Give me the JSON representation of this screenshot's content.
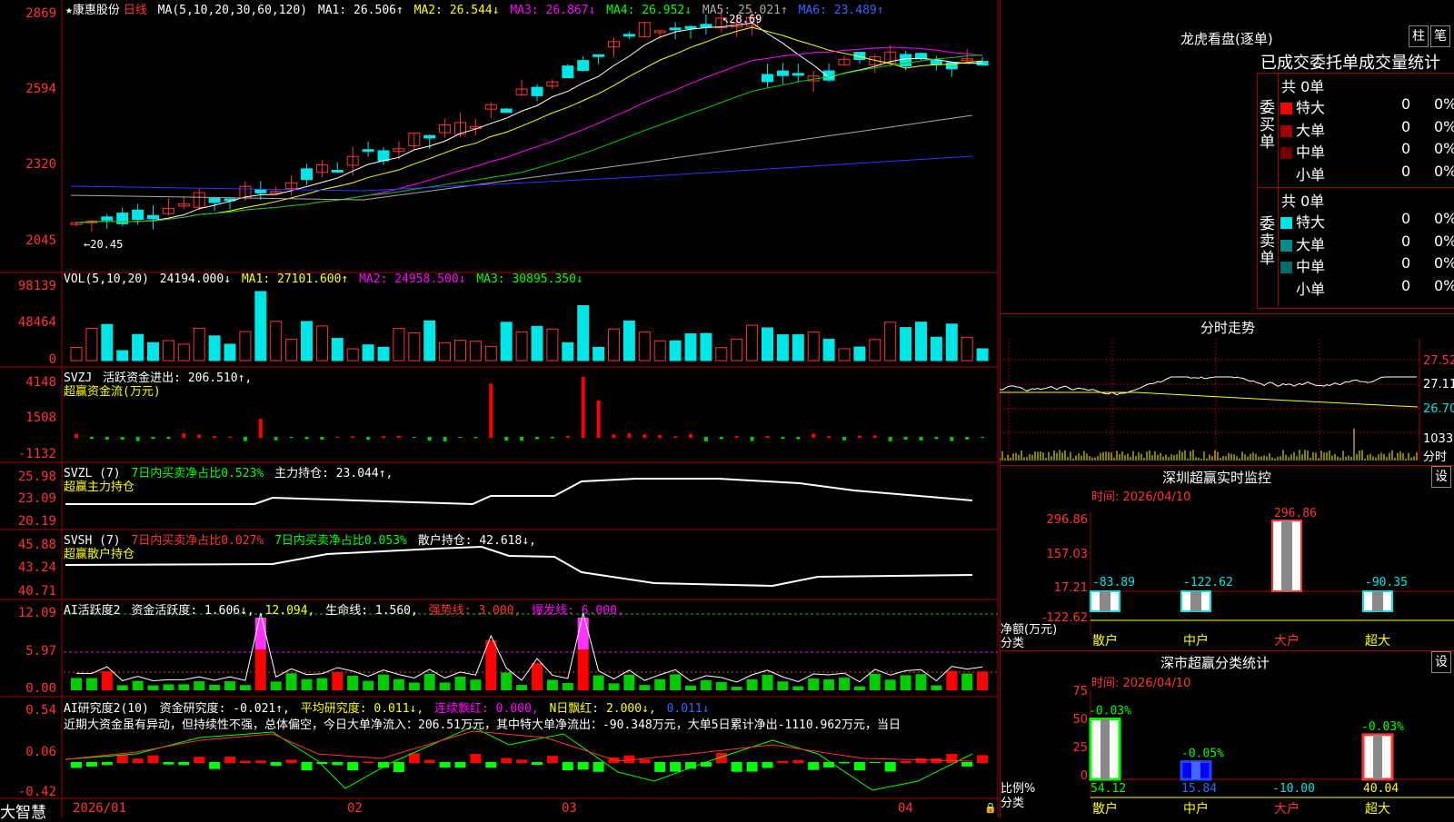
{
  "stock": {
    "name": "★康惠股份",
    "period": "日线"
  },
  "ma_header": {
    "label": "MA(5,10,20,30,60,120)",
    "ma1": "MA1: 26.506↑",
    "ma2": "MA2: 26.544↓",
    "ma3": "MA3: 26.867↓",
    "ma4": "MA4: 26.952↓",
    "ma5": "MA5: 25.021↑",
    "ma6": "MA6: 23.489↑"
  },
  "price_axis": [
    "2869",
    "2594",
    "2320",
    "2045"
  ],
  "price_notes": {
    "high": "28.69",
    "low": "20.45"
  },
  "vol": {
    "label": "VOL(5,10,20)",
    "v": "24194.000↓",
    "ma1": "MA1: 27101.600↑",
    "ma2": "MA2: 24958.500↓",
    "ma3": "MA3: 30895.350↓",
    "axis": [
      "98139",
      "48464",
      "0"
    ]
  },
  "svzj": {
    "label": "SVZJ",
    "text": "活跃资金进出: 206.510↑,",
    "sub": "超赢资金流(万元)",
    "axis": [
      "4148",
      "1508",
      "-1132"
    ]
  },
  "svzl": {
    "label": "SVZL (7)",
    "t1": "7日内买卖净占比0.523%",
    "t2": "主力持仓: 23.044↑,",
    "sub": "超赢主力持仓",
    "axis": [
      "25.98",
      "23.09",
      "20.19"
    ]
  },
  "svsh": {
    "label": "SVSH (7)",
    "t1": "7日内买卖净占比0.027%",
    "t2": "7日内买卖净占比0.053%",
    "t3": "散户持仓: 42.618↓,",
    "sub": "超赢散户持仓",
    "axis": [
      "45.88",
      "43.24",
      "40.71"
    ]
  },
  "ai1": {
    "label": "AI活跃度2",
    "t1": "资金活跃度: 1.606↓,",
    "t2": "12.094,",
    "t3": "生命线: 1.560,",
    "t4": "强势线: 3.000,",
    "t5": "爆发线: 6.000,",
    "axis": [
      "12.09",
      "5.97",
      "0.00"
    ]
  },
  "ai2": {
    "label": "AI研究度2(10)",
    "t1": "资金研究度: -0.021↑,",
    "t2": "平均研究度: 0.011↓,",
    "t3": "连续飘红: 0.000,",
    "t4": "N日飘红: 2.000↓,",
    "t5": "0.011↓",
    "note": "近期大资金虽有异动，但持续性不强，总体偏空，今日大单净流入：206.51万元，其中特大单净流出：-90.348万元，大单5日累计净出-1110.962万元，当日",
    "axis": [
      "0.54",
      "0.06",
      "-0.42"
    ]
  },
  "dates": [
    "2026/01",
    "02",
    "03",
    "04"
  ],
  "brand": "大智慧",
  "right": {
    "title": "龙虎看盘(逐单)",
    "btn1": "柱",
    "btn2": "笔",
    "tabs": "已成交委托单成交量统计",
    "buy": {
      "label": "委买单",
      "count": "共 0单",
      "rows": [
        {
          "name": "特大",
          "v": "0",
          "p": "0%",
          "c": "#ff0000"
        },
        {
          "name": "大单",
          "v": "0",
          "p": "0%",
          "c": "#a00000"
        },
        {
          "name": "中单",
          "v": "0",
          "p": "0%",
          "c": "#700000"
        },
        {
          "name": "小单",
          "v": "0",
          "p": "0%",
          "c": ""
        }
      ]
    },
    "sell": {
      "label": "委卖单",
      "count": "共 0单",
      "rows": [
        {
          "name": "特大",
          "v": "0",
          "p": "0%",
          "c": "#00e5e5"
        },
        {
          "name": "大单",
          "v": "0",
          "p": "0%",
          "c": "#008b8b"
        },
        {
          "name": "中单",
          "v": "0",
          "p": "0%",
          "c": "#006b6b"
        },
        {
          "name": "小单",
          "v": "0",
          "p": "0%",
          "c": ""
        }
      ]
    },
    "intraday": {
      "title": "分时走势",
      "axis": [
        "27.52",
        "27.11",
        "26.70"
      ],
      "vol": "1033",
      "vol_label": "分时"
    },
    "monitor": {
      "title": "深圳超赢实时监控",
      "btn": "设",
      "time": "时间: 2026/04/10",
      "axis": [
        "296.86",
        "157.03",
        "17.21",
        "-122.62"
      ],
      "ylabel": "净额(万元)",
      "xlabel": "分类",
      "values": [
        {
          "cat": "散户",
          "v": "-83.89",
          "n": -83.89
        },
        {
          "cat": "中户",
          "v": "-122.62",
          "n": -122.62
        },
        {
          "cat": "大户",
          "v": "296.86",
          "n": 296.86
        },
        {
          "cat": "超大",
          "v": "-90.35",
          "n": -90.35
        }
      ]
    },
    "classify": {
      "title": "深市超赢分类统计",
      "btn": "设",
      "time": "时间: 2026/04/10",
      "axis": [
        "75",
        "50",
        "25",
        "0"
      ],
      "ylabel": "比例%",
      "xlabel": "分类",
      "values": [
        {
          "cat": "散户",
          "v": "54.12",
          "chg": "-0.03%",
          "n": 54.12
        },
        {
          "cat": "中户",
          "v": "15.84",
          "chg": "-0.05%",
          "n": 15.84
        },
        {
          "cat": "大户",
          "v": "-10.00",
          "chg": "",
          "n": -10.0
        },
        {
          "cat": "超大",
          "v": "40.04",
          "chg": "-0.03%",
          "n": 40.04
        }
      ]
    }
  }
}
